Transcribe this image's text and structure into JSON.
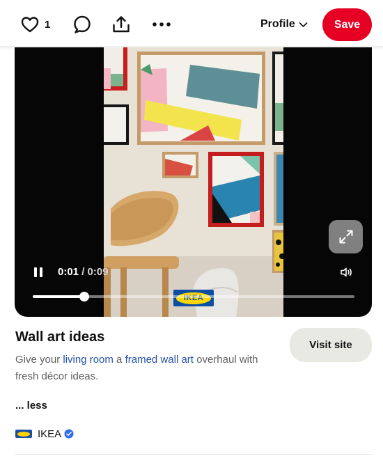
{
  "toolbar": {
    "like_count": "1",
    "profile_label": "Profile",
    "save_label": "Save"
  },
  "video": {
    "current_time": "0:01",
    "separator": "/",
    "duration": "0:09",
    "progress": 0.16,
    "brand_logo_text": "IKEA"
  },
  "pin": {
    "title": "Wall art ideas",
    "description_part1": "Give your ",
    "link1": "living room",
    "description_part2": " a ",
    "link2": "framed wall art",
    "description_part3": " overhaul with fresh décor ideas.",
    "visit_label": "Visit site",
    "less_label": "... less"
  },
  "creator": {
    "name": "IKEA"
  },
  "colors": {
    "save_red": "#e60023",
    "link_blue": "#2451a6",
    "verified_blue": "#2e6cf0"
  }
}
